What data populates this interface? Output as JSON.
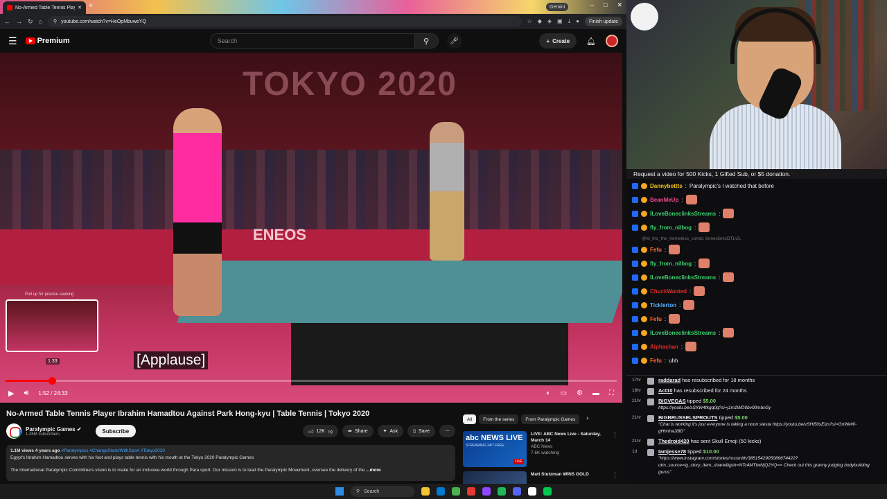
{
  "browser": {
    "tab_title": "No-Armed Table Tennis Player",
    "new_tab": "+",
    "gemini_label": "Gemini",
    "url": "youtube.com/watch?v=HeOpMbuweYQ",
    "finish_update": "Finish update"
  },
  "youtube": {
    "logo_text": "Premium",
    "search_placeholder": "Search",
    "create_label": "Create"
  },
  "player": {
    "banner_text": "TOKYO 2020",
    "sponsor_text": "ENEOS",
    "seek_hint": "Pull up for precise seeking",
    "seek_preview_time": "1:33",
    "caption": "[Applause]",
    "time_display": "1:52 / 24:33",
    "progress_fraction": 0.076
  },
  "video": {
    "title": "No-Armed Table Tennis Player Ibrahim Hamadtou Against Park Hong-kyu | Table Tennis | Tokyo 2020",
    "channel_name": "Paralympic Games",
    "subscribers": "1.45M subscribers",
    "subscribe_label": "Subscribe",
    "likes": "12K",
    "share_label": "Share",
    "ask_label": "Ask",
    "save_label": "Save",
    "views_age": "1.1M views  4 years ago",
    "hashtags": "#Paralympics #ChangeStartsWithSport #Tokyo2020",
    "desc_line1": "Egypt's Ibrahim Hamadtou serves with his foot and plays table tennis with his mouth at the Tokyo 2020 Paralympic Games",
    "desc_line2": "The International Paralympic Committee's vision is to make for an inclusive world through Para sport. Our mission is to lead the Paralympic Movement, oversee the delivery of the",
    "more_label": "...more"
  },
  "sidebar": {
    "chips": [
      "All",
      "From the series",
      "From Paralympic Games"
    ],
    "recs": [
      {
        "thumb_title": "abc NEWS LIVE",
        "thumb_sub": "STREAMING 24/7 FREE",
        "thumb_badge": "LIVE",
        "title": "LIVE: ABC News Live - Saturday, March 14",
        "channel": "ABC News",
        "meta": "7.6K watching"
      },
      {
        "title": "Matt Stutzman WINS GOLD",
        "channel": "",
        "meta": ""
      }
    ]
  },
  "chat": {
    "banner": "Request a video for 500 Kicks, 1 Gifted Sub, or $5 donation.",
    "messages": [
      {
        "user": "Dannybottts",
        "color": "#f5c518",
        "text": "Paralympic's I watched that before",
        "emote": false
      },
      {
        "user": "BeanMeUp",
        "color": "#e94a8c",
        "text": "",
        "emote": true
      },
      {
        "user": "ILoveBoneclinksStreams",
        "color": "#3bd16f",
        "text": "",
        "emote": true
      },
      {
        "user": "fly_from_nilbog",
        "color": "#3bd16f",
        "text": "",
        "emote": true
      },
      {
        "reply": "@el_thc_the_homeless_comic: boneclinksDTLUL"
      },
      {
        "user": "Fefu",
        "color": "#ff6b3d",
        "text": "",
        "emote": true
      },
      {
        "user": "fly_from_nilbog",
        "color": "#3bd16f",
        "text": "",
        "emote": true
      },
      {
        "user": "ILoveBoneclinksStreams",
        "color": "#3bd16f",
        "text": "",
        "emote": true
      },
      {
        "user": "ChuckWanted",
        "color": "#e02a2a",
        "text": "",
        "emote": true
      },
      {
        "user": "Ticklerton",
        "color": "#5ab0ff",
        "text": "",
        "emote": true
      },
      {
        "user": "Fefu",
        "color": "#ff6b3d",
        "text": "",
        "emote": true
      },
      {
        "user": "ILoveBoneclinksStreams",
        "color": "#3bd16f",
        "text": "",
        "emote": true
      },
      {
        "user": "Alphachan",
        "color": "#e02a2a",
        "text": "",
        "emote": true
      },
      {
        "user": "Fefu",
        "color": "#ff6b3d",
        "text": "uhh",
        "emote": false
      }
    ],
    "events": [
      {
        "ago": "17hr",
        "user": "raddarad",
        "text": "has resubscribed for 18 months"
      },
      {
        "ago": "18hr",
        "user": "Act10",
        "text": "has resubscribed for 24 months"
      },
      {
        "ago": "21hr",
        "user": "BIGVEGAS",
        "text": "tipped",
        "amount": "$5.00",
        "quote": "https://youtu.be/sSXW4tkgq0g?si=j1m1WD0bv00mbnSy"
      },
      {
        "ago": "21hr",
        "user": "BIGBRUSSELSPROUTS",
        "text": "tipped",
        "amount": "$5.00",
        "quote": "\"Chat is working it's just everyone is taking a noon siesta https://youtu.be/vSHi50sElzs?si=GnWeW-gHhnhaJt8D\""
      },
      {
        "ago": "21hr",
        "user": "Thedroid420",
        "text": "has sent Skull Emoji (50 kicks)"
      },
      {
        "ago": "1d",
        "user": "Iamjesse78",
        "text": "tipped",
        "amount": "$10.00",
        "quote": "\"https://www.instagram.com/stories/rossmith/3851542905089674422?utm_source=ig_story_item_share&igsh=NTc4MTIwNjQ2YQ== Check out this granny judging bodybuilding gurus\""
      }
    ]
  },
  "taskbar": {
    "search_placeholder": "Search"
  }
}
